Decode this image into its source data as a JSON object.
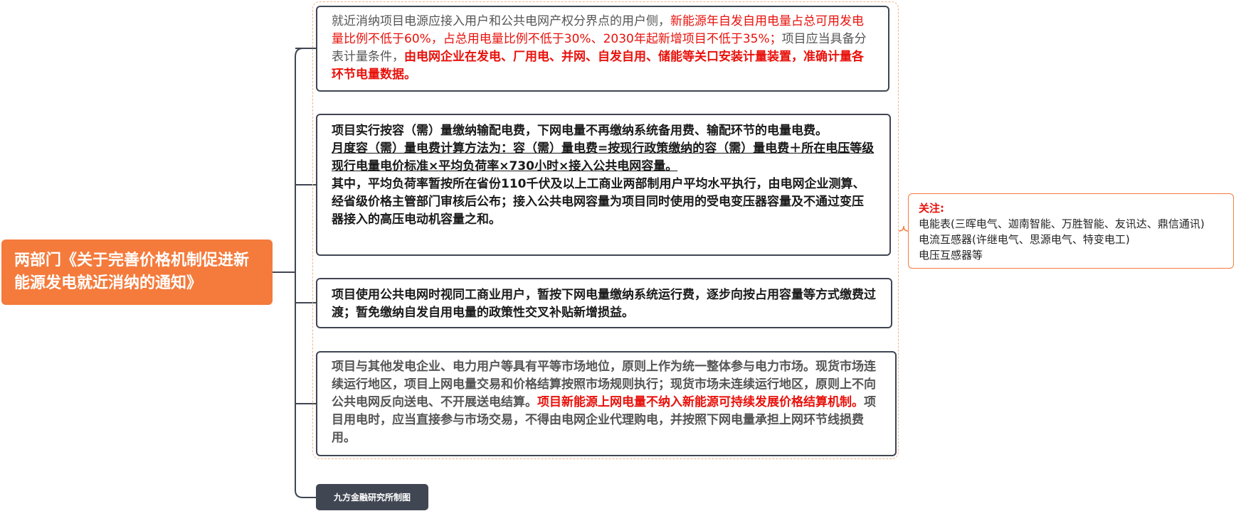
{
  "root": {
    "title": "两部门《关于完善价格机制促进新能源发电就近消纳的通知》"
  },
  "nodes": [
    {
      "segments": [
        {
          "text": "就近消纳项目电源应接入用户和公共电网产权分界点的用户侧，",
          "style": "gray"
        },
        {
          "text": "新能源年自发自用电量占总可用发电量比例不低于60%，占总用电量比例不低于30%、2030年起新增项目不低于35%；",
          "style": "red"
        },
        {
          "text": "项目应当具备分表计量条件，",
          "style": "gray"
        },
        {
          "text": "由电网企业在发电、厂用电、并网、自发自用、储能等关口安装计量装置，准确计量各环节电量数据。",
          "style": "redb"
        }
      ]
    },
    {
      "paragraphs": [
        {
          "text": "项目实行按容（需）量缴纳输配电费，下网电量不再缴纳系统备用费、输配环节的电量电费。",
          "style": "bold"
        },
        {
          "text": "月度容（需）量电费计算方法为：容（需）量电费=按现行政策缴纳的容（需）量电费＋所在电压等级现行电量电价标准×平均负荷率×730小时×接入公共电网容量。",
          "style": "bold ul"
        },
        {
          "text": "其中，平均负荷率暂按所在省份110千伏及以上工商业两部制用户平均水平执行，由电网企业测算、经省级价格主管部门审核后公布；接入公共电网容量为项目同时使用的受电变压器容量及不通过变压器接入的高压电动机容量之和。",
          "style": "bold"
        }
      ]
    },
    {
      "segments": [
        {
          "text": "项目使用公共电网时视同工商业用户，暂按下网电量缴纳系统运行费，逐步向按占用容量等方式缴费过渡；暂免缴纳自发自用电量的政策性交叉补贴新增损益。",
          "style": "bold black"
        }
      ]
    },
    {
      "segments": [
        {
          "text": "项目与其他发电企业、电力用户等具有平等市场地位，原则上作为统一整体参与电力市场。现货市场连续运行地区，项目上网电量交易和价格结算按照市场规则执行；现货市场未连续运行地区，原则上不向公共电网反向送电、不开展送电结算。",
          "style": "gray bold"
        },
        {
          "text": "项目新能源上网电量不纳入新能源可持续发展价格结算机制。",
          "style": "redb"
        },
        {
          "text": "项目用电时，应当直接参与市场交易，不得由电网企业代理购电，并按照下网电量承担上网环节线损费用。",
          "style": "gray bold"
        }
      ]
    }
  ],
  "side_note": {
    "title": "关注:",
    "lines": [
      "电能表(三晖电气、迦南智能、万胜智能、友讯达、鼎信通讯)",
      "电流互感器(许继电气、思源电气、特变电工)",
      "电压互感器等"
    ]
  },
  "footer": {
    "label": "九方金融研究所制图"
  },
  "colors": {
    "root_bg": "#f47b3c",
    "node_border": "#404652",
    "highlight_red": "#e8120c",
    "dashed_border": "#f4b38a"
  }
}
